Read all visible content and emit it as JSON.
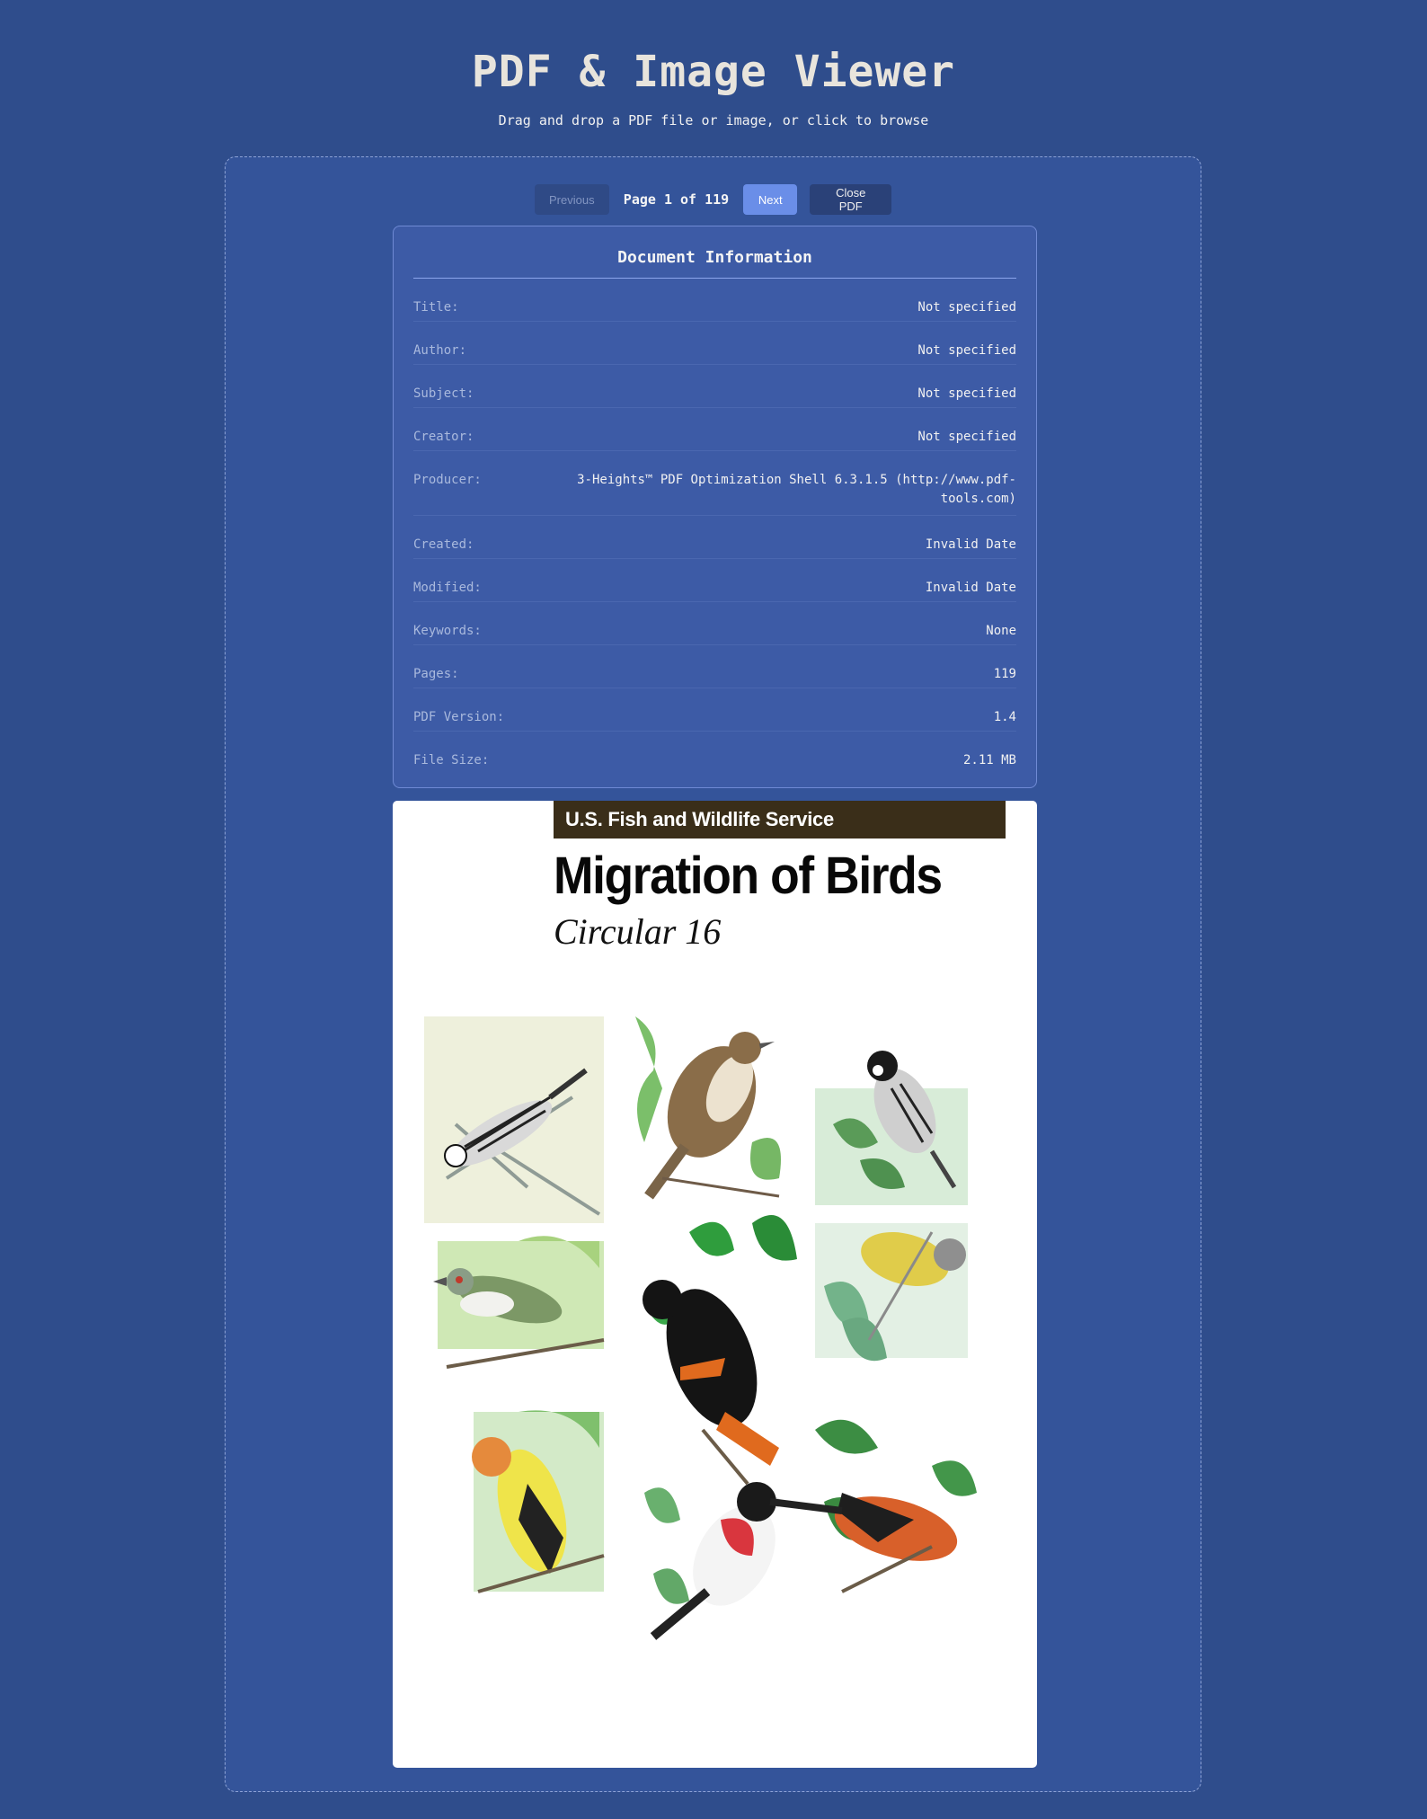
{
  "header": {
    "title": "PDF & Image Viewer",
    "subtitle": "Drag and drop a PDF file or image, or click to browse"
  },
  "controls": {
    "previous_label": "Previous",
    "page_indicator": "Page 1 of 119",
    "next_label": "Next",
    "close_label": "Close PDF"
  },
  "info": {
    "heading": "Document Information",
    "rows": [
      {
        "label": "Title:",
        "value": "Not specified"
      },
      {
        "label": "Author:",
        "value": "Not specified"
      },
      {
        "label": "Subject:",
        "value": "Not specified"
      },
      {
        "label": "Creator:",
        "value": "Not specified"
      },
      {
        "label": "Producer:",
        "value": "3-Heights™ PDF Optimization Shell 6.3.1.5 (http://www.pdf-tools.com)"
      },
      {
        "label": "Created:",
        "value": "Invalid Date"
      },
      {
        "label": "Modified:",
        "value": "Invalid Date"
      },
      {
        "label": "Keywords:",
        "value": "None"
      },
      {
        "label": "Pages:",
        "value": "119"
      },
      {
        "label": "PDF Version:",
        "value": "1.4"
      },
      {
        "label": "File Size:",
        "value": "2.11 MB"
      }
    ]
  },
  "document_page": {
    "banner": "U.S. Fish and Wildlife Service",
    "title": "Migration of Birds",
    "subtitle": "Circular 16"
  },
  "colors": {
    "background": "#2f4d8c",
    "next_button": "#6a8ee8",
    "banner": "#3a2e19"
  }
}
